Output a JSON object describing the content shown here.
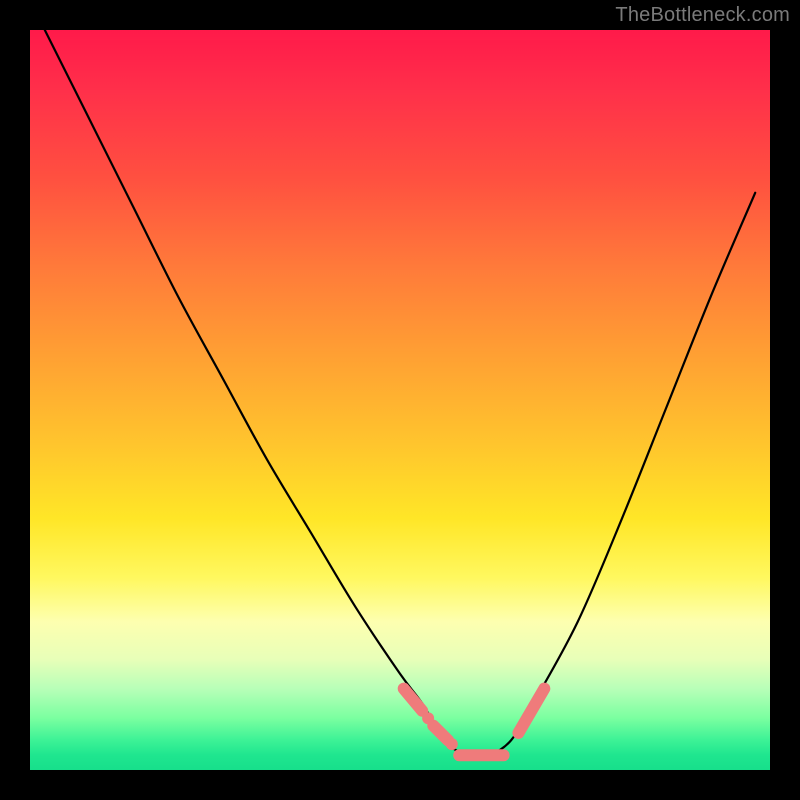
{
  "watermark": "TheBottleneck.com",
  "colors": {
    "marker": "#ef7b7b",
    "curve": "#000000",
    "frame": "#000000"
  },
  "chart_data": {
    "type": "line",
    "title": "",
    "xlabel": "",
    "ylabel": "",
    "xlim": [
      0,
      100
    ],
    "ylim": [
      0,
      100
    ],
    "grid": false,
    "series": [
      {
        "name": "bottleneck-curve",
        "x": [
          2,
          8,
          14,
          20,
          26,
          32,
          38,
          44,
          50,
          53,
          56,
          59,
          62,
          65,
          68,
          74,
          80,
          86,
          92,
          98
        ],
        "values": [
          100,
          88,
          76,
          64,
          53,
          42,
          32,
          22,
          13,
          9,
          4,
          2,
          2,
          4,
          9,
          20,
          34,
          49,
          64,
          78
        ]
      }
    ],
    "annotations": {
      "optimal_range_x": [
        53,
        68
      ],
      "marker_segments": [
        {
          "x": [
            50.5,
            53.0
          ],
          "y": [
            11.0,
            8.0
          ]
        },
        {
          "x": [
            54.5,
            56.5
          ],
          "y": [
            6.0,
            4.0
          ]
        },
        {
          "x": [
            58.0,
            64.0
          ],
          "y": [
            2.0,
            2.0
          ]
        },
        {
          "x": [
            66.0,
            69.5
          ],
          "y": [
            5.0,
            11.0
          ]
        }
      ],
      "marker_dots": [
        {
          "x": 53.8,
          "y": 7.0
        },
        {
          "x": 57.0,
          "y": 3.5
        }
      ]
    }
  }
}
